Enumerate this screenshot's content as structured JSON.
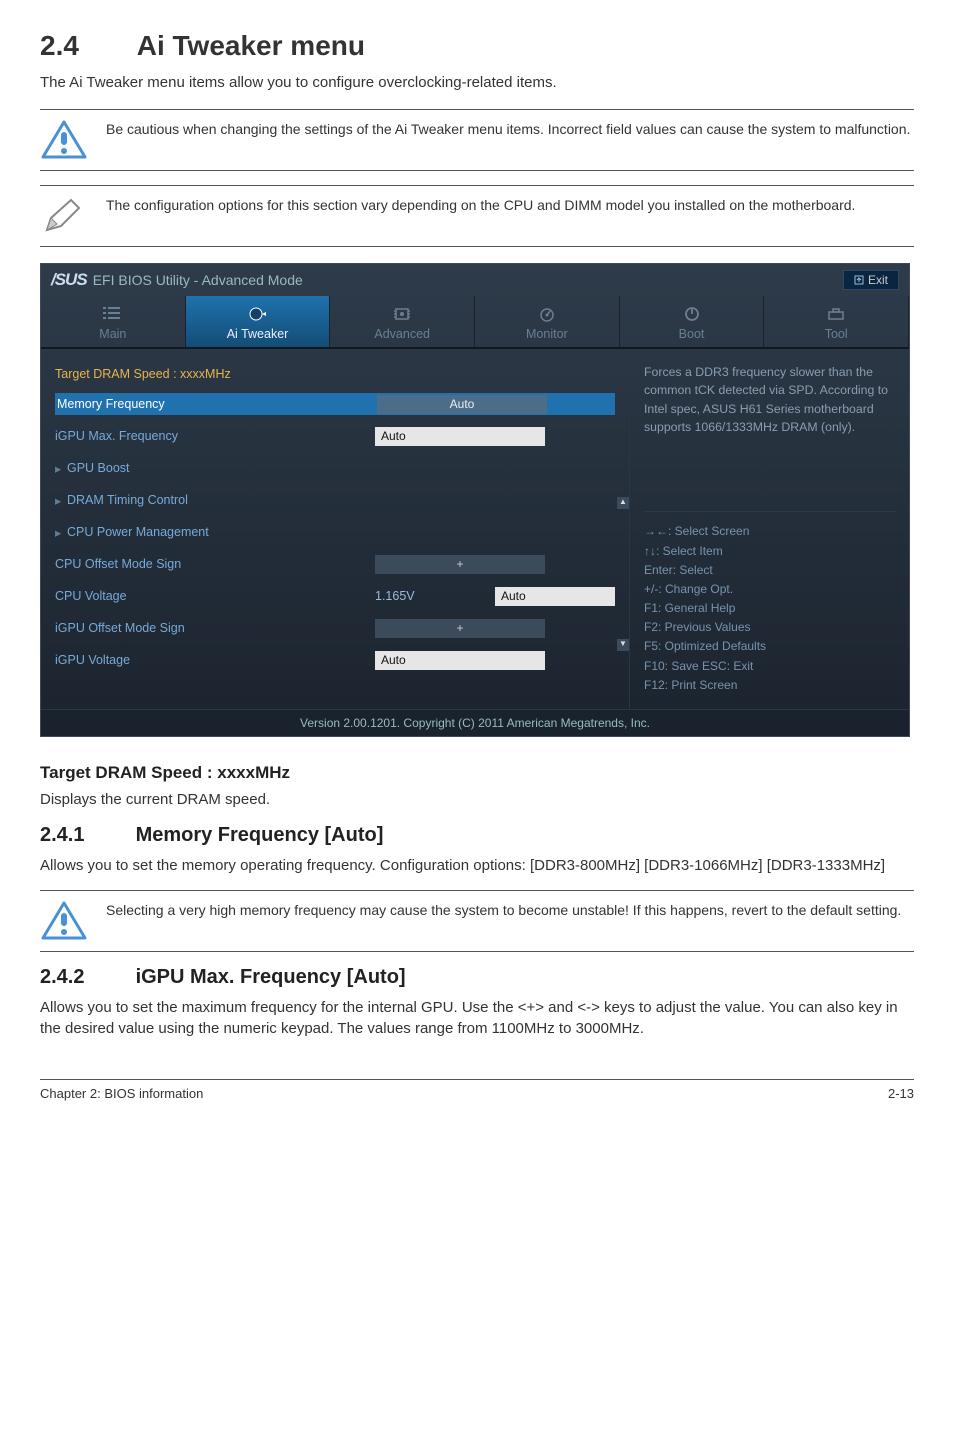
{
  "page": {
    "sectionNum": "2.4",
    "sectionTitle": "Ai Tweaker menu",
    "intro": "The Ai Tweaker menu items allow you to configure overclocking-related items.",
    "warn1": "Be cautious when changing the settings of the Ai Tweaker menu items. Incorrect field values can cause the system to malfunction.",
    "note1": "The configuration options for this section vary depending on the CPU and DIMM model you installed on the motherboard.",
    "h3a": "Target DRAM Speed : xxxxMHz",
    "p_a": "Displays the current DRAM speed.",
    "sub1num": "2.4.1",
    "sub1title": "Memory Frequency [Auto]",
    "p_b": "Allows you to set the memory operating frequency. Configuration options: [DDR3-800MHz] [DDR3-1066MHz] [DDR3-1333MHz]",
    "warn2": "Selecting a very high memory frequency may cause the system to become unstable! If this happens, revert to the default setting.",
    "sub2num": "2.4.2",
    "sub2title": "iGPU Max. Frequency [Auto]",
    "p_c": "Allows you to set the maximum frequency for the internal GPU. Use the <+> and <-> keys to adjust the value. You can also key in the desired value using the numeric keypad. The values range from 1100MHz to 3000MHz.",
    "footerLeft": "Chapter 2: BIOS information",
    "footerRight": "2-13"
  },
  "bios": {
    "brand": "/SUS",
    "title": "EFI BIOS Utility - Advanced Mode",
    "exit": "Exit",
    "tabs": {
      "main": "Main",
      "ai": "Ai  Tweaker",
      "adv": "Advanced",
      "mon": "Monitor",
      "boot": "Boot",
      "tool": "Tool"
    },
    "rows": {
      "target": "Target DRAM Speed : xxxxMHz",
      "memfreq": "Memory Frequency",
      "memfreq_val": "Auto",
      "igpumax": "iGPU Max. Frequency",
      "igpumax_val": "Auto",
      "gpuboost": "GPU Boost",
      "dramtiming": "DRAM Timing Control",
      "cpupower": "CPU Power Management",
      "cpuoffset": "CPU Offset Mode Sign",
      "cpuoffset_val": "+",
      "cpuvolt": "CPU Voltage",
      "cpuvolt_val": "1.165V",
      "cpuvolt_field": "Auto",
      "igpuoffset": "iGPU Offset Mode Sign",
      "igpuoffset_val": "+",
      "igpuvolt": "iGPU Voltage",
      "igpuvolt_val": "Auto"
    },
    "help": "Forces a DDR3 frequency slower than the common tCK detected via SPD. According to Intel spec, ASUS H61 Series motherboard supports 1066/1333MHz DRAM (only).",
    "keys": {
      "k1": "→←: Select Screen",
      "k2": "↑↓: Select Item",
      "k3": "Enter: Select",
      "k4": "+/-: Change Opt.",
      "k5": "F1: General Help",
      "k6": "F2: Previous Values",
      "k7": "F5: Optimized Defaults",
      "k8": "F10: Save   ESC: Exit",
      "k9": "F12: Print Screen"
    },
    "footer": "Version  2.00.1201.   Copyright  (C)  2011  American  Megatrends,  Inc."
  }
}
